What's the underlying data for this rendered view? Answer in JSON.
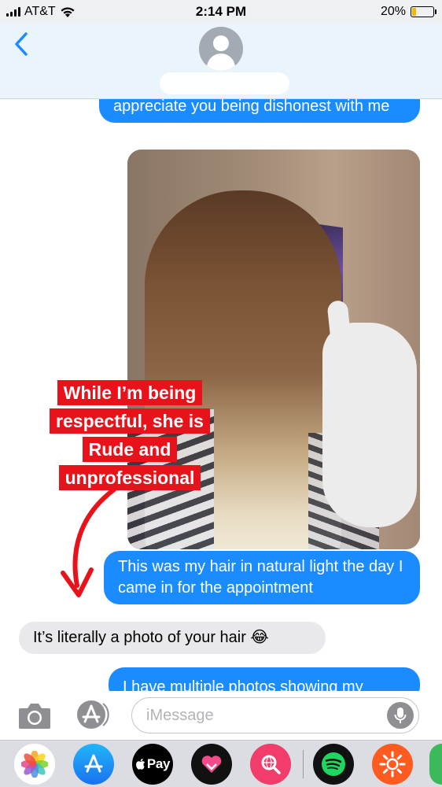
{
  "status_bar": {
    "carrier": "AT&T",
    "time": "2:14 PM",
    "battery_percent": "20%",
    "battery_level": 0.2
  },
  "header": {
    "back_icon": "chevron-left-icon",
    "avatar_icon": "person-silhouette-icon"
  },
  "messages": [
    {
      "direction": "sent",
      "text": "appreciate you being dishonest with me"
    },
    {
      "direction": "sent",
      "type": "photo",
      "alt_icon": "photo-attachment"
    },
    {
      "direction": "sent",
      "text": "This was my hair in natural light the day I came in for the appointment"
    },
    {
      "direction": "received",
      "text": "It’s literally a photo of your hair 😂"
    },
    {
      "direction": "sent",
      "text": "I have multiple photos showing my"
    }
  ],
  "annotation": {
    "text": "While I’m being respectful, she is Rude and unprofessional",
    "color": "#e8121a"
  },
  "input_bar": {
    "placeholder": "iMessage",
    "camera_icon": "camera-icon",
    "apps_icon": "app-store-icon",
    "mic_icon": "microphone-icon"
  },
  "app_drawer": {
    "apps": [
      {
        "name": "photos-app-icon"
      },
      {
        "name": "app-store-app-icon"
      },
      {
        "name": "apple-pay-app-icon",
        "label": "Pay"
      },
      {
        "name": "heart-app-icon"
      },
      {
        "name": "web-search-app-icon"
      },
      {
        "name": "spotify-app-icon"
      },
      {
        "name": "sun-app-icon"
      }
    ]
  },
  "colors": {
    "sent_bubble": "#1a8cff",
    "received_bubble": "#e9e9eb",
    "ios_blue": "#1a8cff"
  }
}
